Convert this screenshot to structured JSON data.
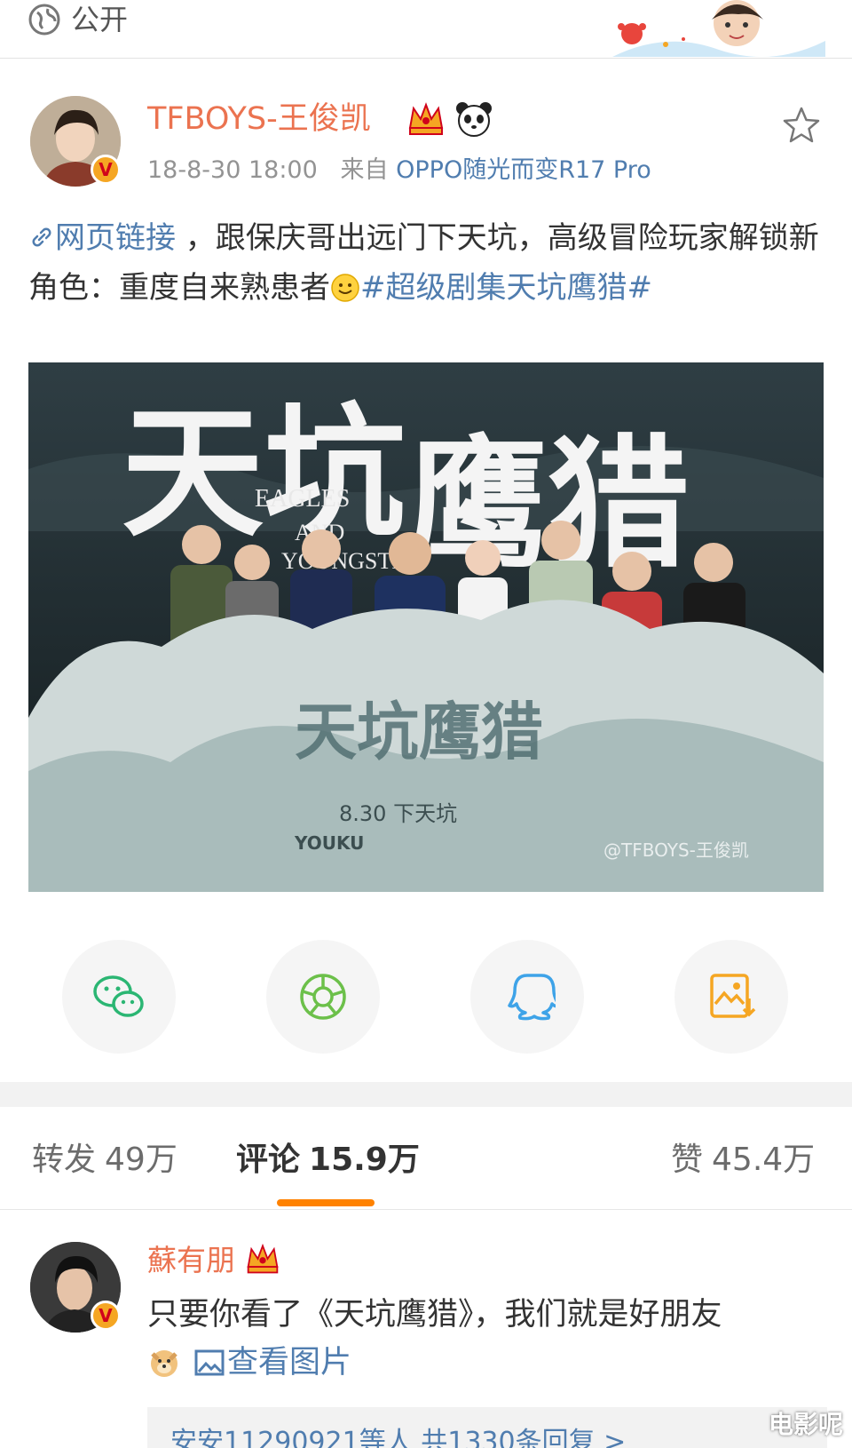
{
  "topbar": {
    "visibility": "公开"
  },
  "post": {
    "author": "TFBOYS-王俊凯",
    "date": "18-8-30 18:00",
    "source_prefix": "来自",
    "source": "OPPO随光而变R17 Pro",
    "link_text": "网页链接",
    "text_1": " ，跟保庆哥出远门下天坑，高级冒险玩家解锁新角色：重度自来熟患者",
    "hashtag": "#超级剧集天坑鹰猎#",
    "image": {
      "title_cn": "天坑鹰猎",
      "title_en_1": "EAGLES",
      "title_en_2": "AND",
      "title_en_3": "YOUNGSTER",
      "date_caption": "8.30 下天坑",
      "brand": "YOUKU",
      "watermark": "@TFBOYS-王俊凯"
    }
  },
  "share": {
    "icons": [
      "wechat-icon",
      "moments-icon",
      "qq-icon",
      "save-image-icon"
    ],
    "colors": {
      "wechat": "#2bb673",
      "moments": "#6cc04a",
      "qq": "#3ea3e8",
      "save": "#f5a623"
    }
  },
  "tabs": {
    "repost_label": "转发",
    "repost_count": "49万",
    "comment_label": "评论",
    "comment_count": "15.9万",
    "like_label": "赞",
    "like_count": "45.4万"
  },
  "comment": {
    "author": "蘇有朋",
    "text": "只要你看了《天坑鹰猎》，我们就是好朋友",
    "view_image": "查看图片",
    "replies": "安安11290921等人 共1330条回复 >"
  },
  "page_watermark": "电影呢",
  "colors": {
    "accent": "#ff8200",
    "name": "#eb7350",
    "link": "#507daf"
  }
}
